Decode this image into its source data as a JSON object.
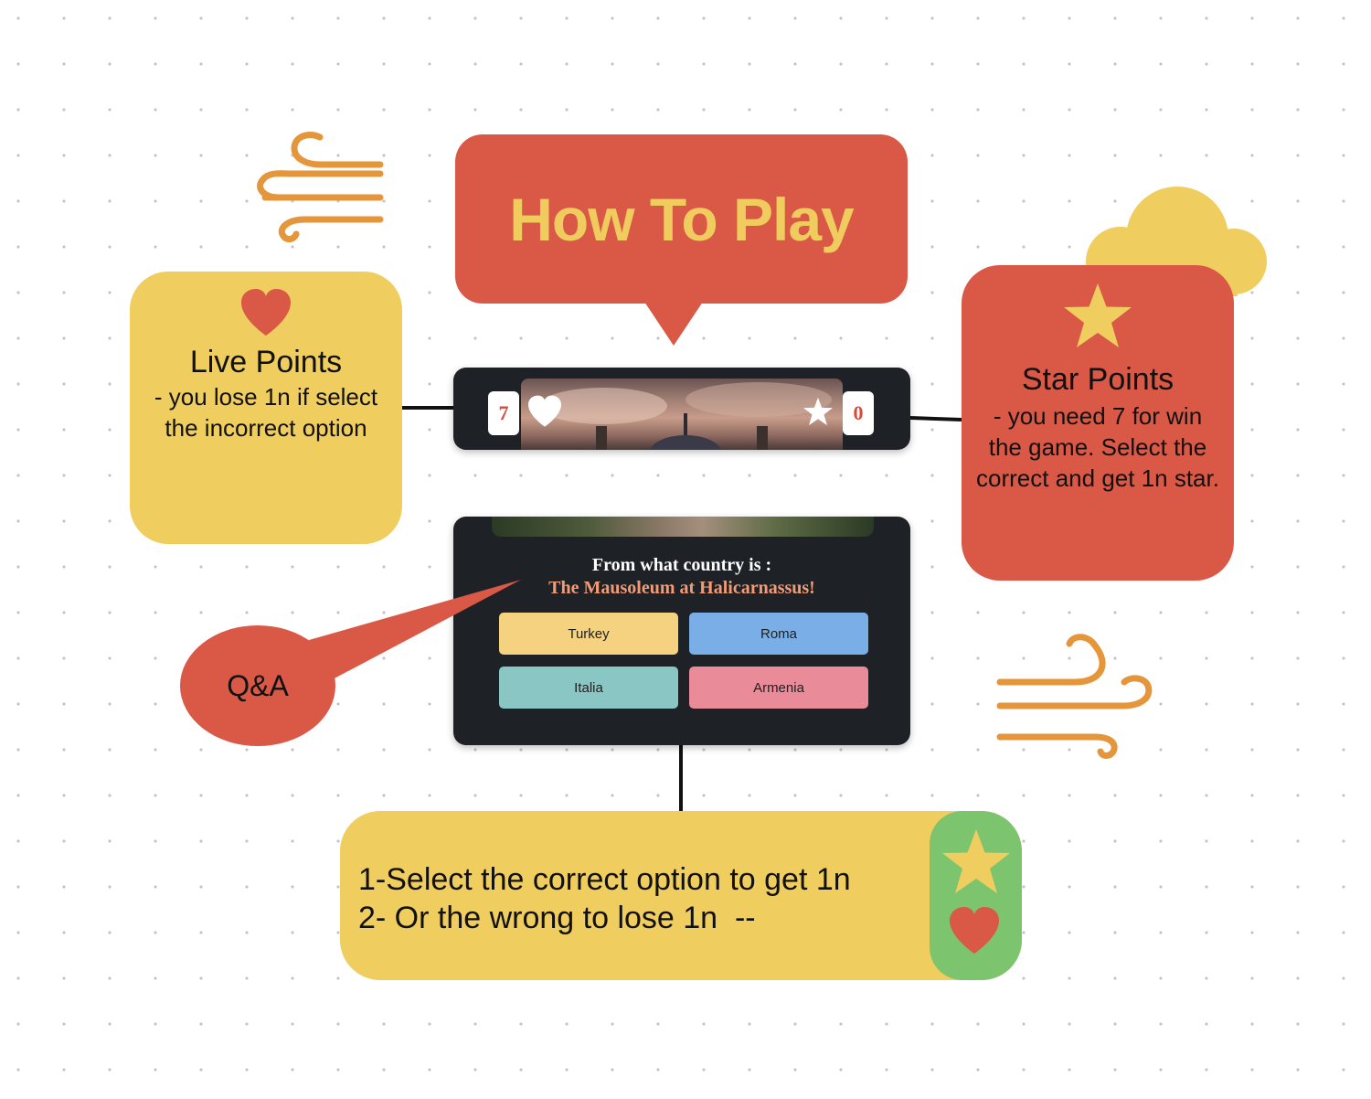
{
  "title": "How To Play",
  "live_points": {
    "title": "Live Points",
    "description": "- you lose 1n if select the incorrect option"
  },
  "star_points": {
    "title": "Star Points",
    "description": "- you need 7 for win the game. Select the correct and get 1n star."
  },
  "game_header": {
    "lives": "7",
    "stars": "0"
  },
  "quiz": {
    "question": "From what country is :",
    "subject": "The Mausoleum at Halicarnassus!",
    "options": [
      {
        "label": "Turkey",
        "color": "#f4d27f"
      },
      {
        "label": "Roma",
        "color": "#7aaee6"
      },
      {
        "label": "Italia",
        "color": "#8ac6c4"
      },
      {
        "label": "Armenia",
        "color": "#e98b98"
      }
    ]
  },
  "qa_label": "Q&A",
  "instructions": {
    "line1": "1-Select the correct option to get 1n",
    "line2": "2- Or the wrong to lose 1n  --"
  },
  "colors": {
    "red": "#d95846",
    "yellow": "#f0cd5f",
    "green": "#7dc46e",
    "orange": "#e5953a",
    "dark_panel": "#1e2125"
  },
  "icons": [
    "wind-icon",
    "cloud-icon",
    "heart-icon",
    "star-icon"
  ]
}
